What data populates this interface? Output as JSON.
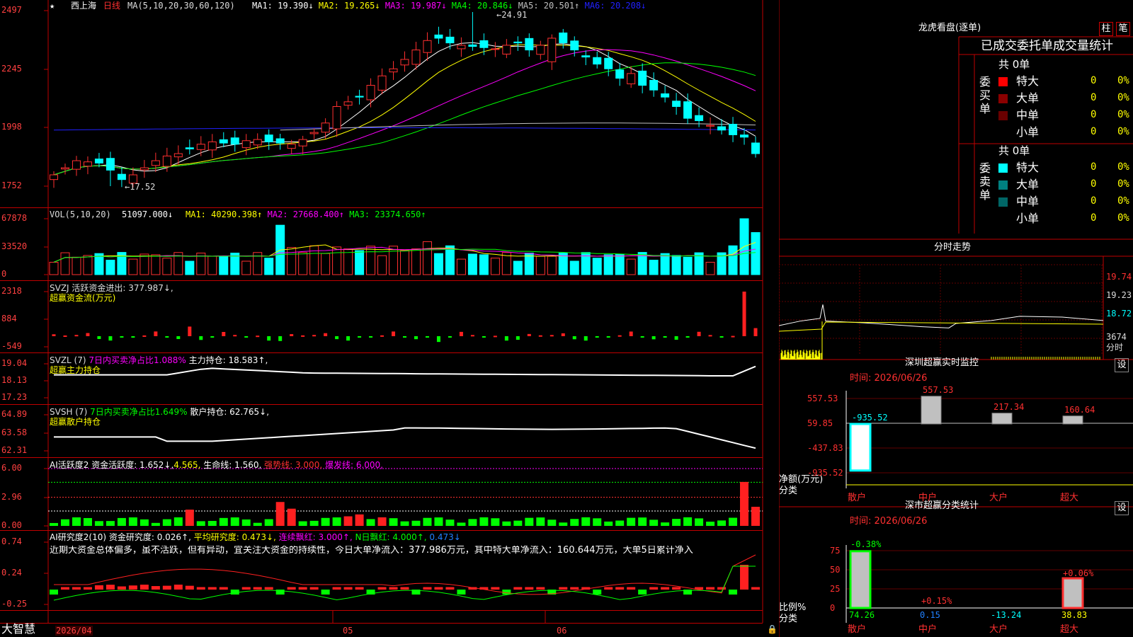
{
  "header": {
    "star": "★",
    "stock_name": "西上海",
    "period": "日线",
    "ma_params": "MA(5,10,20,30,60,120)",
    "ma_values": [
      {
        "label": "MA1: 19.390↓",
        "color": "#ffffff"
      },
      {
        "label": "MA2: 19.265↓",
        "color": "#ffff00"
      },
      {
        "label": "MA3: 19.987↓",
        "color": "#ff00ff"
      },
      {
        "label": "MA4: 20.846↓",
        "color": "#00ff00"
      },
      {
        "label": "MA5: 20.501↑",
        "color": "#c0c0c0"
      },
      {
        "label": "MA6: 20.208↓",
        "color": "#2020ff"
      }
    ]
  },
  "colors": {
    "up": "#ff3030",
    "down": "#00ffff",
    "grid": "#c00000",
    "axis_text": "#ff4040",
    "bg": "#000000"
  },
  "y_axes": {
    "price": [
      "2497",
      "2245",
      "1998",
      "1752"
    ],
    "vol": [
      "67878",
      "33520",
      "0"
    ],
    "svzj": [
      "2318",
      "884",
      "-549"
    ],
    "svzl": [
      "19.04",
      "18.13",
      "17.23"
    ],
    "svsh": [
      "64.89",
      "63.58",
      "62.31"
    ],
    "ai": [
      "6.00",
      "2.96",
      "0.00"
    ],
    "yj": [
      "0.74",
      "0.24",
      "-0.25"
    ]
  },
  "price_annotations": {
    "high": "24.91",
    "low": "17.52"
  },
  "indicators": {
    "vol": {
      "params": "VOL(5,10,20)",
      "value": "51097.000↓",
      "ma": [
        {
          "label": "MA1: 40290.398↑",
          "color": "#ffff00"
        },
        {
          "label": "MA2: 27668.400↑",
          "color": "#ff00ff"
        },
        {
          "label": "MA3: 23374.650↑",
          "color": "#00ff00"
        }
      ]
    },
    "svzj": {
      "line1": "SVZJ  活跃资金进出: 377.987↓,",
      "line2": "超赢资金流(万元)"
    },
    "svzl": {
      "line1a": "SVZL (7) ",
      "line1b": "7日内买卖净占比1.088%",
      "line1c": " 主力持仓: 18.583↑,",
      "line2": "超赢主力持仓"
    },
    "svsh": {
      "line1a": "SVSH (7) ",
      "line1b": "7日内买卖净占比1.649%",
      "line1c": " 散户持仓: 62.765↓,",
      "line2": "超赢散户持仓"
    },
    "ai": {
      "a": "AI活跃度2 资金活跃度: 1.652↓,",
      "b": "4.565,",
      "c": " 生命线: 1.560,",
      "d": " 强势线: 3.000,",
      "e": " 爆发线: 6.000,"
    },
    "yj": {
      "a": "AI研究度2(10) 资金研究度: 0.026↑,",
      "b": " 平均研究度: 0.473↓,",
      "c": " 连续飘红: 3.000↑,",
      "d": " N日飘红: 4.000↑,",
      "e": " 0.473↓"
    },
    "yj_comment": "近期大资金总体偏多，虽不活跃，但有异动，宜关注大资金的持续性，今日大单净流入：377.986万元，其中特大单净流入：160.644万元，大单5日累计净入"
  },
  "x_axis": {
    "labels": [
      "2026/04",
      "05",
      "06"
    ],
    "corner": "大智慧"
  },
  "dragon": {
    "title": "龙虎看盘(逐单)",
    "btn_zhu": "柱",
    "btn_bi": "笔",
    "subtitle": "已成交委托单成交量统计",
    "buy": {
      "side": "委买单",
      "total": "共 0单",
      "rows": [
        {
          "name": "特大",
          "count": "0",
          "pct": "0%",
          "color": "#ff0000"
        },
        {
          "name": "大单",
          "count": "0",
          "pct": "0%",
          "color": "#8b0000"
        },
        {
          "name": "中单",
          "count": "0",
          "pct": "0%",
          "color": "#6a0000"
        },
        {
          "name": "小单",
          "count": "0",
          "pct": "0%",
          "color": "#000000"
        }
      ]
    },
    "sell": {
      "side": "委卖单",
      "total": "共 0单",
      "rows": [
        {
          "name": "特大",
          "count": "0",
          "pct": "0%",
          "color": "#00ffff"
        },
        {
          "name": "大单",
          "count": "0",
          "pct": "0%",
          "color": "#008080"
        },
        {
          "name": "中单",
          "count": "0",
          "pct": "0%",
          "color": "#006666"
        },
        {
          "name": "小单",
          "count": "0",
          "pct": "0%",
          "color": "#000000"
        }
      ]
    }
  },
  "intraday": {
    "title": "分时走势",
    "prices": [
      "19.74",
      "19.23",
      "18.72"
    ],
    "vol": "3674",
    "vol_label": "分时"
  },
  "monitor": {
    "title": "深圳超赢实时监控",
    "settings": "设",
    "time": "时间: 2026/06/26",
    "y_ticks": [
      "557.53",
      "59.85",
      "-437.83",
      "-935.52"
    ],
    "y_label": "净额(万元)",
    "x_label": "分类",
    "categories": [
      "散户",
      "中户",
      "大户",
      "超大"
    ],
    "values": [
      -935.52,
      557.53,
      217.34,
      160.64
    ],
    "value_labels": [
      "-935.52",
      "557.53",
      "217.34",
      "160.64"
    ]
  },
  "classify": {
    "title": "深市超赢分类统计",
    "settings": "设",
    "time": "时间: 2026/06/26",
    "y_ticks": [
      "75",
      "50",
      "25",
      "0"
    ],
    "y_label": "比例%",
    "x_label": "分类",
    "categories": [
      "散户",
      "中户",
      "大户",
      "超大"
    ],
    "bar_values": [
      74.26,
      0.15,
      13.24,
      38.83
    ],
    "top_labels": [
      "-0.38%",
      "+0.15%",
      "",
      "+0.06%"
    ],
    "bottom_values": [
      "74.26",
      "0.15",
      "-13.24",
      "38.83"
    ]
  },
  "chart_data": [
    {
      "type": "candlestick",
      "title": "西上海 日线",
      "xlabel": "",
      "ylabel": "",
      "x": [
        "2026/04",
        "05",
        "06"
      ],
      "ylim": [
        17.0,
        25.2
      ],
      "series": [
        {
          "name": "MA1",
          "values": [
            19.39
          ]
        },
        {
          "name": "MA2",
          "values": [
            19.265
          ]
        },
        {
          "name": "MA3",
          "values": [
            19.987
          ]
        },
        {
          "name": "MA4",
          "values": [
            20.846
          ]
        },
        {
          "name": "MA5",
          "values": [
            20.501
          ]
        },
        {
          "name": "MA6",
          "values": [
            20.208
          ]
        }
      ],
      "high": 24.91,
      "low": 17.52
    },
    {
      "type": "bar",
      "title": "VOL(5,10,20)",
      "ylim": [
        0,
        67878
      ],
      "values": [
        51097
      ]
    },
    {
      "type": "bar",
      "title": "SVZJ",
      "ylim": [
        -549,
        2318
      ],
      "values": [
        377.987
      ]
    }
  ]
}
